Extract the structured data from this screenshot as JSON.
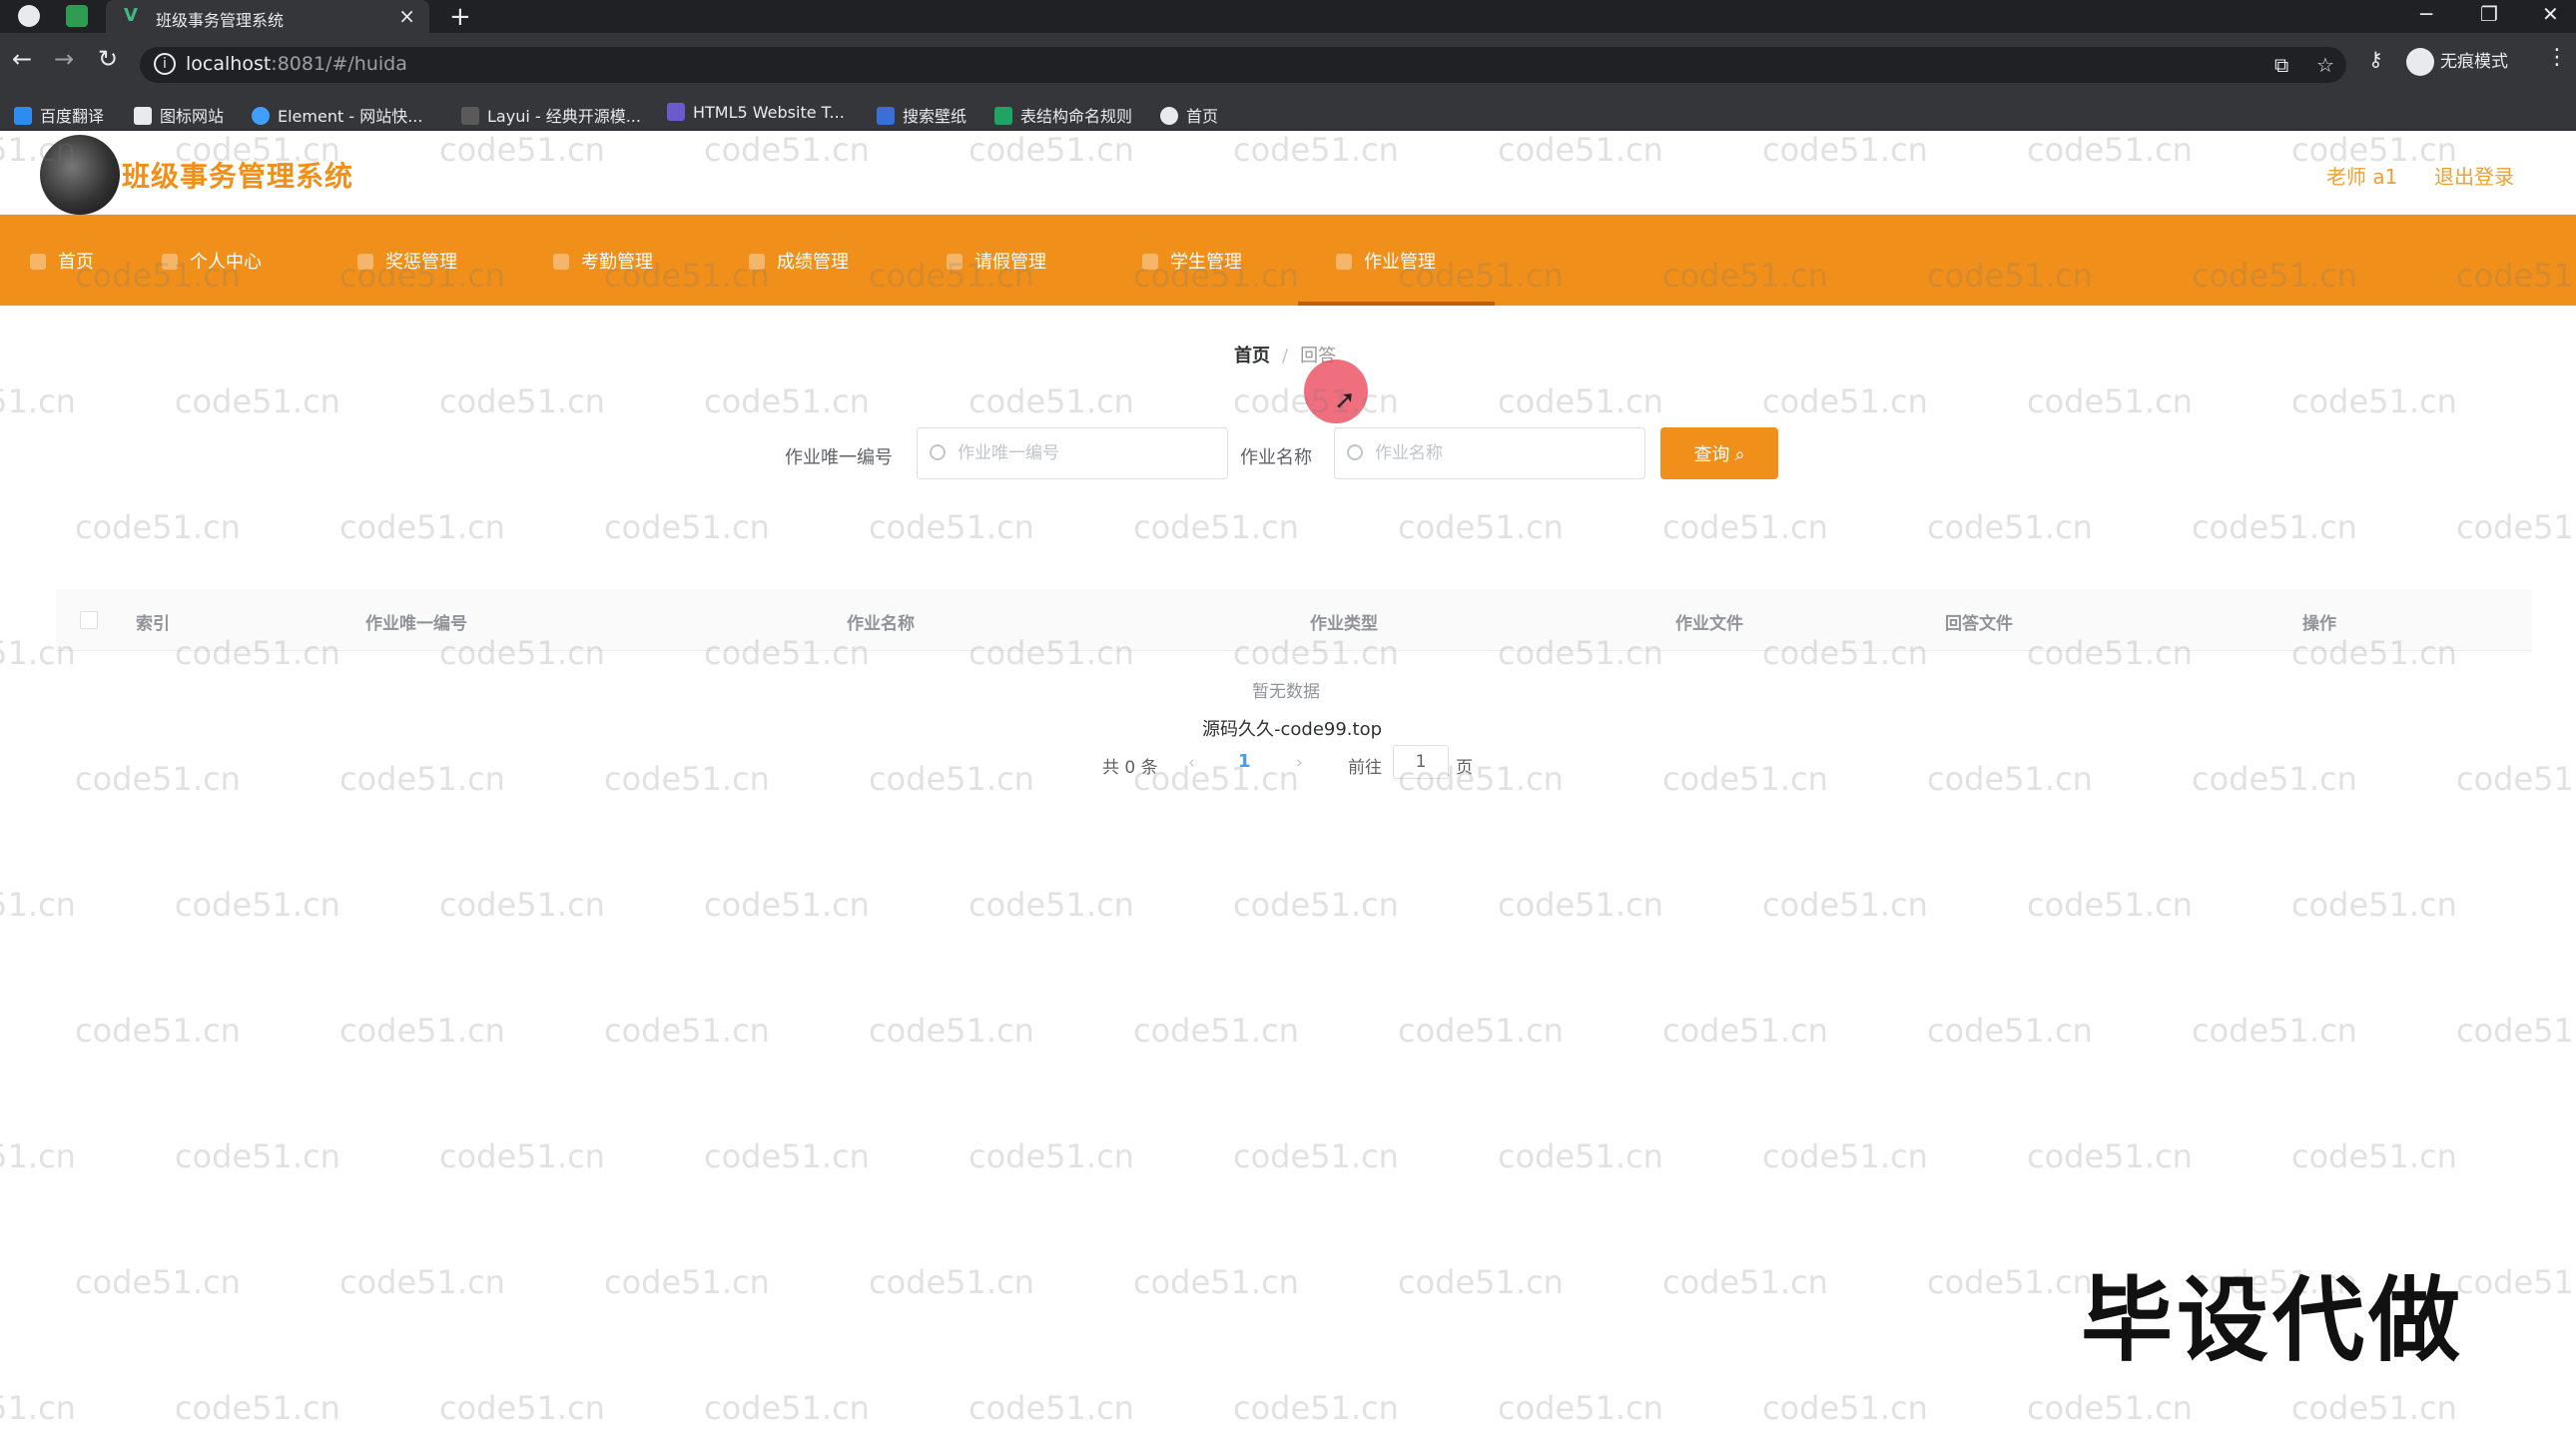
{
  "browser": {
    "tab_title": "班级事务管理系统",
    "url_host": "localhost",
    "url_rest": ":8081/#/huida",
    "profile_label": "无痕模式",
    "bookmarks": [
      "百度翻译",
      "图标网站",
      "Element - 网站快...",
      "Layui - 经典开源模...",
      "HTML5 Website T...",
      "搜索壁纸",
      "表结构命名规则",
      "首页"
    ]
  },
  "header": {
    "title": "班级事务管理系统",
    "user": "老师 a1",
    "logout": "退出登录"
  },
  "nav": {
    "items": [
      "首页",
      "个人中心",
      "奖惩管理",
      "考勤管理",
      "成绩管理",
      "请假管理",
      "学生管理",
      "作业管理"
    ],
    "active": "作业管理"
  },
  "breadcrumb": {
    "home": "首页",
    "separator": "/",
    "current": "回答"
  },
  "search": {
    "field1_label": "作业唯一编号",
    "field1_placeholder": "作业唯一编号",
    "field2_label": "作业名称",
    "field2_placeholder": "作业名称",
    "query_button": "查询"
  },
  "table": {
    "columns": [
      "索引",
      "作业唯一编号",
      "作业名称",
      "作业类型",
      "作业文件",
      "回答文件",
      "操作"
    ],
    "empty_text": "暂无数据"
  },
  "source_line": "源码久久-code99.top",
  "pagination": {
    "total": "共 0 条",
    "prev": "‹",
    "current_page": "1",
    "next": "›",
    "goto_label": "前往",
    "goto_value": "1",
    "page_unit": "页"
  },
  "overlay": {
    "watermark": "code51.cn",
    "stamp": "毕设代做"
  },
  "colors": {
    "accent": "#f0901a",
    "chrome_dark": "#202124",
    "chrome_mid": "#35363a"
  }
}
